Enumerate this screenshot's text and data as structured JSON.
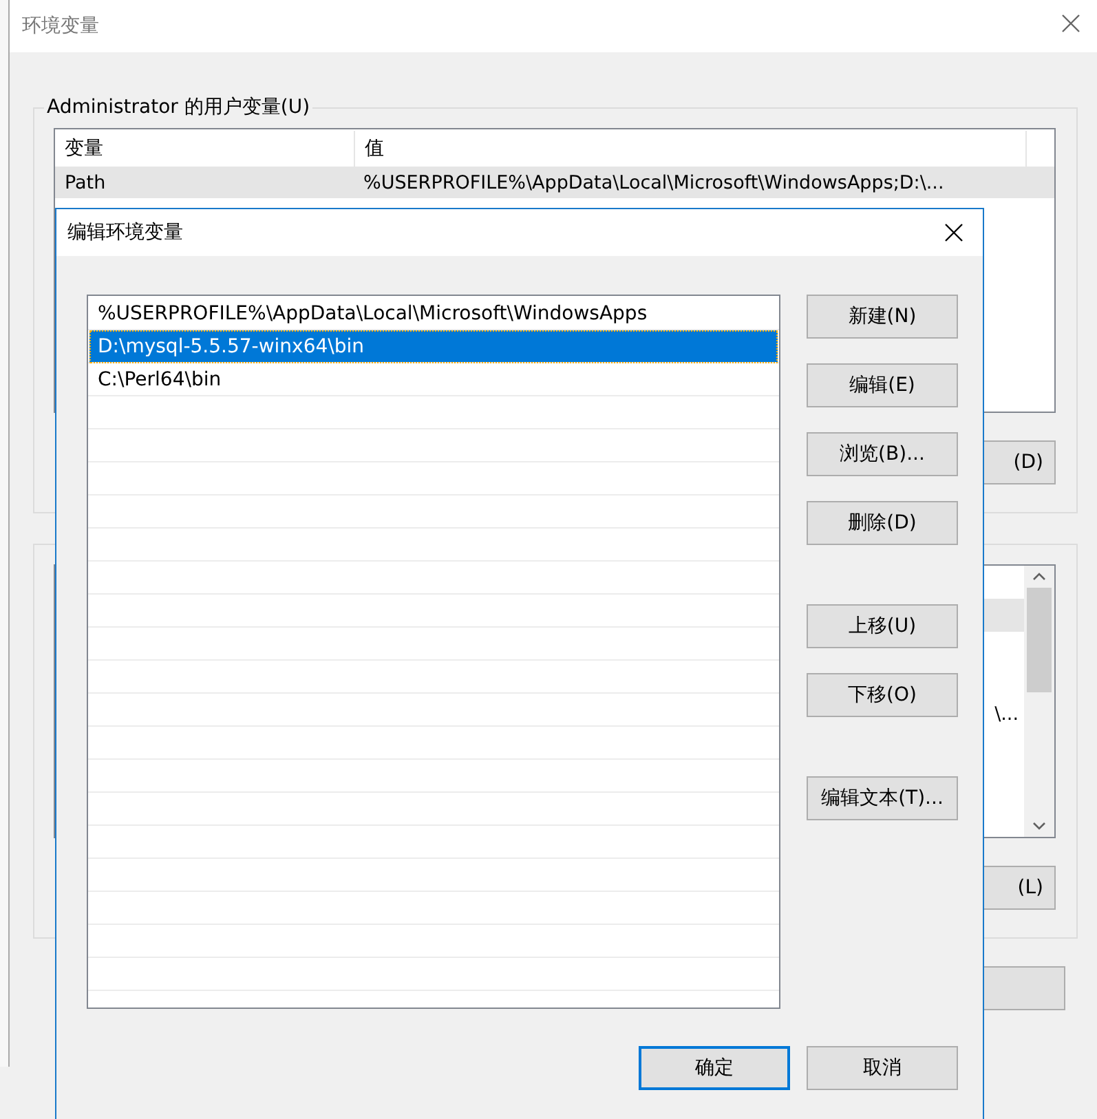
{
  "window": {
    "title": "环境变量"
  },
  "user_variables": {
    "label": "Administrator 的用户变量(U)",
    "columns": [
      "变量",
      "值"
    ],
    "rows": [
      {
        "name": "Path",
        "value": "%USERPROFILE%\\AppData\\Local\\Microsoft\\WindowsApps;D:\\...",
        "selected": true
      }
    ],
    "button": "(D)"
  },
  "system_variables": {
    "rows": [
      {
        "selected": false
      },
      {
        "selected": true
      },
      {
        "selected": false
      },
      {
        "selected": false
      },
      {
        "text": "\\...",
        "selected": false
      }
    ],
    "button": "(L)"
  },
  "dialog": {
    "title": "编辑环境变量",
    "entries": [
      {
        "text": "%USERPROFILE%\\AppData\\Local\\Microsoft\\WindowsApps",
        "selected": false
      },
      {
        "text": "D:\\mysql-5.5.57-winx64\\bin",
        "selected": true
      },
      {
        "text": "C:\\Perl64\\bin",
        "selected": false
      }
    ],
    "side_buttons": [
      [
        "新建(N)",
        "编辑(E)",
        "浏览(B)...",
        "删除(D)"
      ],
      [
        "上移(U)",
        "下移(O)"
      ],
      [
        "编辑文本(T)..."
      ]
    ],
    "footer_buttons": [
      {
        "label": "确定",
        "default": true
      },
      {
        "label": "取消",
        "default": false
      }
    ]
  }
}
